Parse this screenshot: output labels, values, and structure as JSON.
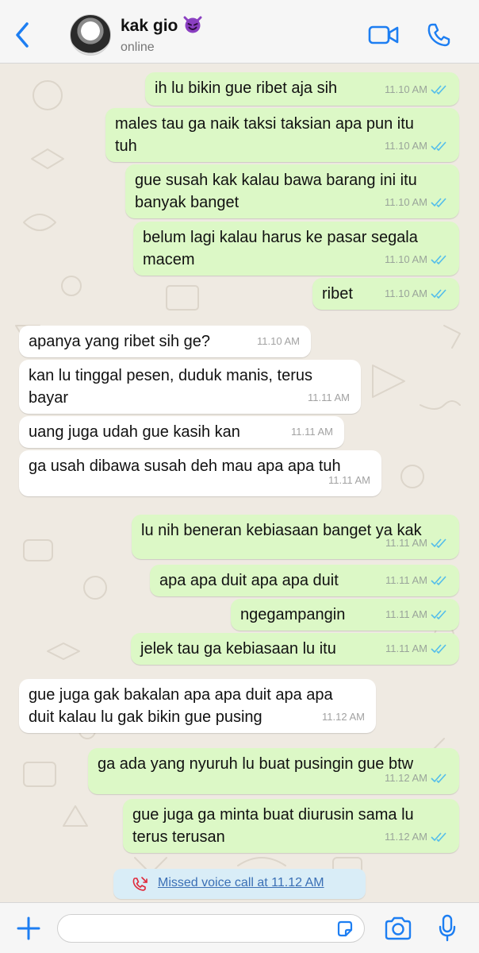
{
  "header": {
    "contact_name": "kak gio",
    "emoji_icon": "smiling-imp-emoji",
    "status": "online"
  },
  "colors": {
    "accent": "#1d7ef2",
    "outgoing_bubble": "#dcf8c6",
    "incoming_bubble": "#ffffff",
    "chat_background": "#efeae2",
    "read_ticks": "#53bdeb",
    "missed_call_red": "#e0283a"
  },
  "messages": [
    {
      "direction": "out",
      "lines": [
        "ih lu bikin gue ribet aja sih"
      ],
      "time": "11.10 AM",
      "read": true
    },
    {
      "direction": "out",
      "lines": [
        "males tau ga naik taksi taksian apa pun itu",
        "tuh"
      ],
      "time": "11.10 AM",
      "read": true
    },
    {
      "direction": "out",
      "lines": [
        "gue susah kak kalau bawa barang ini itu",
        "banyak banget"
      ],
      "time": "11.10 AM",
      "read": true
    },
    {
      "direction": "out",
      "lines": [
        "belum lagi kalau harus ke pasar segala",
        "macem"
      ],
      "time": "11.10 AM",
      "read": true
    },
    {
      "direction": "out",
      "lines": [
        "ribet"
      ],
      "time": "11.10 AM",
      "read": true
    },
    {
      "direction": "in",
      "lines": [
        "apanya yang ribet sih ge?"
      ],
      "time": "11.10 AM"
    },
    {
      "direction": "in",
      "lines": [
        "kan lu tinggal pesen, duduk manis, terus",
        "bayar"
      ],
      "time": "11.11 AM"
    },
    {
      "direction": "in",
      "lines": [
        "uang juga udah gue kasih kan"
      ],
      "time": "11.11 AM"
    },
    {
      "direction": "in",
      "lines": [
        "ga usah dibawa susah deh mau apa apa tuh"
      ],
      "time": "11.11 AM"
    },
    {
      "direction": "out",
      "lines": [
        "lu nih beneran kebiasaan banget ya kak"
      ],
      "time": "11.11 AM",
      "read": true
    },
    {
      "direction": "out",
      "lines": [
        "apa apa duit apa apa duit"
      ],
      "time": "11.11 AM",
      "read": true
    },
    {
      "direction": "out",
      "lines": [
        "ngegampangin"
      ],
      "time": "11.11 AM",
      "read": true
    },
    {
      "direction": "out",
      "lines": [
        "jelek tau ga kebiasaan lu itu"
      ],
      "time": "11.11 AM",
      "read": true
    },
    {
      "direction": "in",
      "lines": [
        "gue juga gak bakalan apa apa duit apa apa",
        "duit kalau lu gak bikin gue pusing"
      ],
      "time": "11.12 AM"
    },
    {
      "direction": "out",
      "lines": [
        "ga ada yang nyuruh lu buat pusingin gue btw"
      ],
      "time": "11.12 AM",
      "read": true
    },
    {
      "direction": "out",
      "lines": [
        "gue juga ga minta buat diurusin sama lu",
        "terus terusan"
      ],
      "time": "11.12 AM",
      "read": true
    }
  ],
  "missed_call": {
    "icon": "missed-call-icon",
    "text": "Missed voice call at 11.12 AM"
  },
  "composer": {
    "input_value": "",
    "placeholder": ""
  }
}
